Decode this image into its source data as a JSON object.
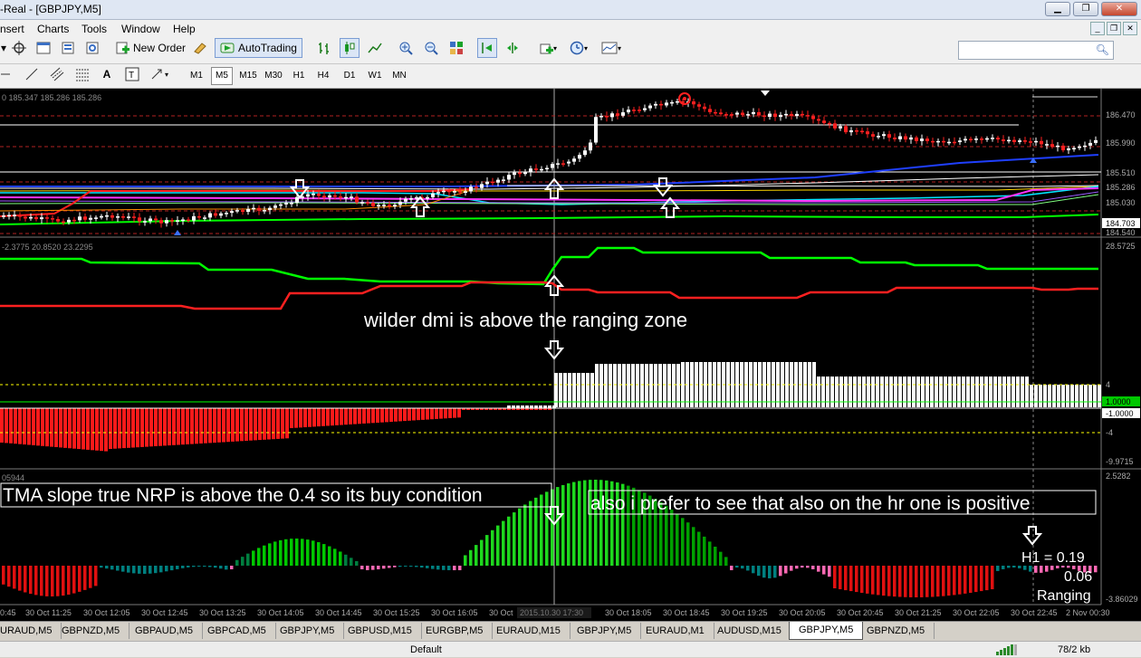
{
  "window": {
    "title": "-Real - [GBPJPY,M5]"
  },
  "menu": [
    "nsert",
    "Charts",
    "Tools",
    "Window",
    "Help"
  ],
  "toolbar": {
    "new_order": "New Order",
    "autotrading": "AutoTrading",
    "timeframes": [
      "M1",
      "M5",
      "M15",
      "M30",
      "H1",
      "H4",
      "D1",
      "W1",
      "MN"
    ],
    "selected_timeframe": "M5"
  },
  "chart": {
    "main_header": "0 185.347 185.286 185.286",
    "price_ticks": [
      "186.470",
      "185.990",
      "185.510",
      "185.286",
      "185.030",
      "184.703",
      "184.540"
    ],
    "current_price": "184.703",
    "dmi_header": "-2.3775 20.8520 23.2295",
    "dmi_scale_top": "28.5725",
    "hist_levels": [
      "4",
      "1.0000",
      "-1.0000",
      "-4",
      "-9.9715"
    ],
    "slope_header": "05944",
    "slope_scale": [
      "2.5282",
      "-3.86029"
    ],
    "time_labels": [
      "30 Oct 11:25",
      "30 Oct 12:05",
      "30 Oct 12:45",
      "30 Oct 13:25",
      "30 Oct 14:05",
      "30 Oct 14:45",
      "30 Oct 15:25",
      "30 Oct 16:05",
      "30 Oct",
      "2015.10.30 17:30",
      "30 Oct 18:05",
      "30 Oct 18:45",
      "30 Oct 19:25",
      "30 Oct 20:05",
      "30 Oct 20:45",
      "30 Oct 21:25",
      "30 Oct 22:05",
      "30 Oct 22:45",
      "2 Nov 00:30"
    ],
    "time_labels_left": "0:45",
    "annotations": {
      "dmi": "wilder dmi is above the ranging zone",
      "tma": "TMA slope true NRP is above the 0.4 so its buy condition",
      "hr": "also i prefer to see that also on the hr one is positive",
      "h1_value": "H1 = 0.19",
      "current_value": "0.06",
      "state": "Ranging"
    }
  },
  "tabs": [
    "URAUD,M5",
    "GBPNZD,M5",
    "GBPAUD,M5",
    "GBPCAD,M5",
    "GBPJPY,M5",
    "GBPUSD,M15",
    "EURGBP,M5",
    "EURAUD,M15",
    "GBPJPY,M5",
    "EURAUD,M1",
    "AUDUSD,M15",
    "GBPJPY,M5",
    "GBPNZD,M5"
  ],
  "active_tab_index": 11,
  "status": {
    "profile": "Default",
    "traffic": "78/2 kb"
  },
  "colors": {
    "bg": "#000000",
    "bull": "#ffffff",
    "bear": "#ff0000",
    "green": "#00ff00",
    "label_green": "#00c800"
  }
}
